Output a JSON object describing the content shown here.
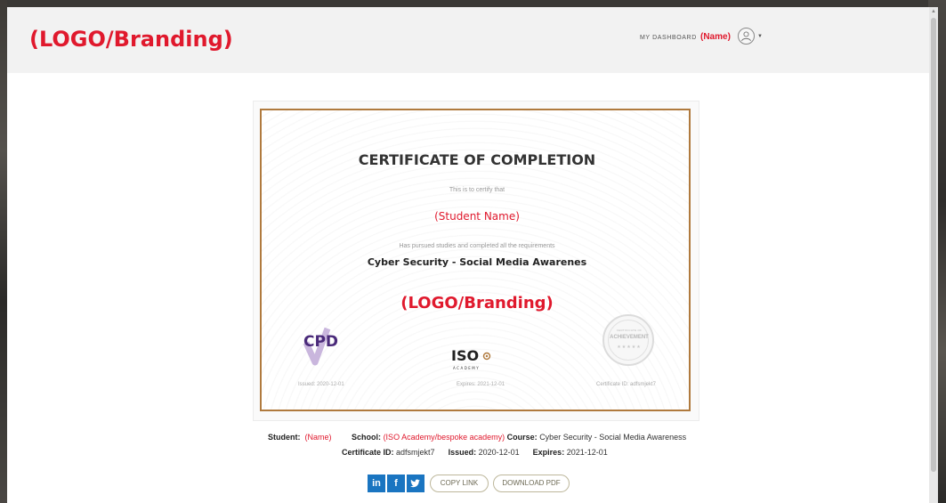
{
  "header": {
    "brand": "(LOGO/Branding)",
    "dashboard_link": "MY DASHBOARD",
    "user_name": "(Name)"
  },
  "certificate": {
    "title": "CERTIFICATE OF COMPLETION",
    "certify_text": "This is to certify that",
    "student_name": "(Student Name)",
    "pursued_text": "Has pursued studies and completed all the requirements",
    "course": "Cyber Security - Social Media Awarenes",
    "brand": "(LOGO/Branding)",
    "cpd_logo": "CPD",
    "iso_logo": "ISO",
    "iso_logo_sub": "ACADEMY",
    "seal_top": "CERTIFICATE OF",
    "seal_main": "ACHIEVEMENT",
    "issued_label": "Issued: 2020-12-01",
    "expires_label": "Expires: 2021-12-01",
    "cert_id_label": "Certificate ID: adfsmjekt7"
  },
  "details": {
    "student_label": "Student:",
    "student_value": "(Name)",
    "school_label": "School:",
    "school_value": "(ISO Academy/bespoke academy)",
    "course_label": "Course:",
    "course_value": "Cyber Security - Social Media Awareness",
    "cert_id_label": "Certificate ID:",
    "cert_id_value": "adfsmjekt7",
    "issued_label": "Issued:",
    "issued_value": "2020-12-01",
    "expires_label": "Expires:",
    "expires_value": "2021-12-01"
  },
  "actions": {
    "linkedin": "in",
    "facebook": "f",
    "copy_link": "COPY LINK",
    "download_pdf": "DOWNLOAD PDF"
  },
  "colors": {
    "brand_red": "#e0192d",
    "frame_gold": "#b07a3e",
    "social_blue": "#1a75c1"
  }
}
